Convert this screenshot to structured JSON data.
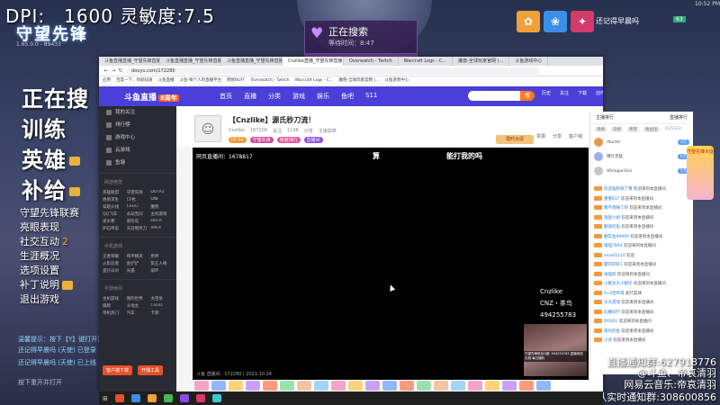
{
  "overlay": {
    "dpi_text": "DPI:　1600 灵敏度:7.5",
    "logo": "守望先锋",
    "version": "1.65.0.0 - 89433",
    "menu_big": [
      "正在搜",
      "训练",
      "英雄",
      "补给"
    ],
    "menu_small": [
      "守望先锋联赛",
      "亮眼表现",
      "社交互动",
      "生涯概况",
      "选项设置",
      "补丁说明",
      "退出游戏"
    ],
    "social_count": "2",
    "notify_1": "温馨提示：按下【Y】键打开游戏内浏览器",
    "notify_2": "还记得早晨吗 (天使) 已登录",
    "notify_3": "还记得早晨吗 (天使) 已上线",
    "hint": "按下重开并打开",
    "clock": "10:52 PM"
  },
  "search_dialog": {
    "title": "正在搜索",
    "time": "等待时间：8:47"
  },
  "player": {
    "name": "还记得早晨吗",
    "level": "63"
  },
  "browser": {
    "tabs": [
      {
        "label": "斗鱼直播直播_守望先锋直播..."
      },
      {
        "label": "斗鱼直播直播_守望先锋直播..."
      },
      {
        "label": "斗鱼直播直播_守望先锋直播..."
      },
      {
        "label": "Cnzlike直播_守望先锋直播"
      },
      {
        "label": "Overwatch - Twitch"
      },
      {
        "label": "Warcraft Logs - C..."
      },
      {
        "label": "魔兽-全球玩家官网 (..."
      },
      {
        "label": "斗鱼游戏中心"
      }
    ],
    "url": "douyu.com/172280",
    "bookmarks": [
      "应用",
      "百度一下，你就知道",
      "斗鱼直播",
      "斗鱼-每个人的直播平台",
      "网易BUFF",
      "Overwatch - Twitch",
      "Warcraft Logs - C...",
      "魔兽-全球玩家官网 (...",
      "斗鱼游戏中心"
    ]
  },
  "douyu": {
    "logo": "斗鱼直播",
    "logo_tag": "8周年",
    "nav": [
      "首页",
      "直播",
      "分类",
      "游戏",
      "娱乐",
      "鱼吧",
      "S11"
    ],
    "search_btn": "搜",
    "icons": [
      "历史",
      "关注",
      "下载",
      "创作",
      "开播"
    ],
    "promo": "你想看的 不错不过",
    "sidebar_top": [
      "我的关注",
      "排行榜",
      "游戏中心",
      "云游戏",
      "鱼塘"
    ],
    "sidebar_sec1": "网游竞技",
    "sidebar_grid1": [
      "英雄联盟",
      "守望先锋",
      "DOTA2",
      "绝地求生",
      "CF枪",
      "DNF",
      "穿越火线",
      "CSGO",
      "魔兽",
      "QQ飞车",
      "永劫无间",
      "主机游戏",
      "逆水寒",
      "冒险岛",
      "DOTA",
      "炉石传说",
      "天涯明月刀",
      "APEX"
    ],
    "sidebar_sec2": "手机游戏",
    "sidebar_grid2": [
      "王者荣耀",
      "和平精英",
      "原神",
      "火影忍者",
      "金铲铲",
      "第五人格",
      "蛋仔派对",
      "光遇",
      "崩坏"
    ],
    "sidebar_sec3": "手游休闲",
    "sidebar_grid3": [
      "主机游戏",
      "我的世界",
      "太空杀",
      "棋牌",
      "斗地主",
      "CSGO",
      "单机热门",
      "汽车",
      "卡牌"
    ],
    "sidebar_btn1": "客户端下载",
    "sidebar_btn2": "开播工具"
  },
  "room": {
    "title": "【Cnzlike】源氏秒刀流！",
    "meta": [
      "Cnzlike",
      "167209",
      "关注",
      "1198",
      "分享",
      "主播勋章"
    ],
    "tags": [
      "LV 52",
      "守望先锋",
      "热度排行",
      "直播间"
    ],
    "actions": [
      "举报",
      "分享",
      "客户端"
    ],
    "ad": "限时大促"
  },
  "video": {
    "live": "网页直播间：1678817",
    "text_1": "算",
    "text_2": "能打我的吗",
    "social": [
      "Cnzlike",
      "CNZ・茶鸟",
      "494255783"
    ],
    "cam_caption": "守望先锋粉丝Q裙: 494255783 直播间抢礼物 每日福利",
    "time": "斗鱼 直播间 · 172280 | 2021.10.24",
    "watermark": "douyu.com"
  },
  "danmu": {
    "tabs": [
      "主播排行",
      "直播排行"
    ],
    "sub_tabs": [
      "周榜",
      "日榜",
      "贵宾",
      "粉丝团"
    ],
    "count": "635323",
    "ranks": [
      {
        "name": "dbaYet",
        "count": "1万"
      },
      {
        "name": "爆炸无敌",
        "count": "6万"
      },
      {
        "name": "X6noganSan",
        "count": "5万"
      }
    ],
    "messages": [
      {
        "name": "欢迎猫狗来了哦",
        "text": " 欢迎来到本直播间"
      },
      {
        "name": "重重637",
        "text": " 欢迎来到本直播间"
      },
      {
        "name": "我不想睡了吧",
        "text": " 欢迎来到本直播间"
      },
      {
        "name": "瑞蛋小组",
        "text": " 欢迎来到本直播间"
      },
      {
        "name": "翻滚的鱼",
        "text": " 欢迎来到本直播间"
      },
      {
        "name": "翻车鱼99999",
        "text": " 欢迎来到本直播间"
      },
      {
        "name": "喵喵7864",
        "text": " 欢迎来到本直播间"
      },
      {
        "name": "vxiu01110",
        "text": " 欢迎"
      },
      {
        "name": "霍的轩轩1",
        "text": " 欢迎来到本直播间"
      },
      {
        "name": "张喵新",
        "text": " 欢迎来到本直播间"
      },
      {
        "name": "小肥龙大小肥仔",
        "text": " 欢迎来到本直播间"
      },
      {
        "name": "Gcd无所谓",
        "text": " 爱打篮球"
      },
      {
        "name": "天天游戏",
        "text": " 欢迎来到本直播间"
      },
      {
        "name": "幻魔同行",
        "text": " 欢迎来到本直播间"
      },
      {
        "name": "DOVEL",
        "text": " 欢迎来到本直播间"
      },
      {
        "name": "冒险的鱼",
        "text": " 欢迎来到本直播间"
      },
      {
        "name": "小虎",
        "text": " 欢迎来到本直播间"
      }
    ],
    "cup_text": "守望先锋大促"
  },
  "stream_overlay": {
    "line1": "直播通知群:627918776",
    "line2": "@斗鱼、帝哀清羽",
    "line3": "网易云音乐:帝哀清羽",
    "line4": "排队实时通知群:308600856"
  },
  "taskbar": {
    "start": "⊞"
  },
  "colors": {
    "douyu_header": "#4a3fd8",
    "douyu_orange": "#ff7a22",
    "sidebar_bg": "#2a2a32",
    "search_dialog": "#322050"
  }
}
